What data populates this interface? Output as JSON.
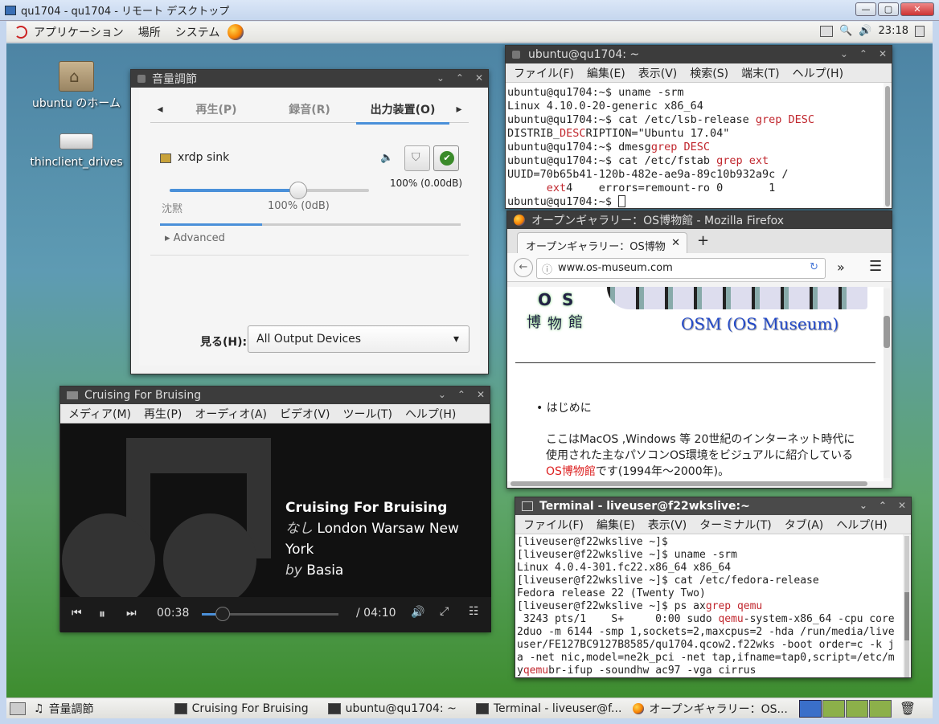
{
  "rdp": {
    "title": "qu1704 - qu1704 - リモート デスクトップ"
  },
  "panel": {
    "menus": [
      "アプリケーション",
      "場所",
      "システム"
    ],
    "clock": "23:18"
  },
  "desktop": {
    "icons": [
      {
        "label": "ubuntu のホーム",
        "icon": "home-folder-icon"
      },
      {
        "label": "thinclient_drives",
        "icon": "drive-icon"
      }
    ]
  },
  "sound": {
    "title": "音量調節",
    "tabs": [
      "再生(P)",
      "録音(R)",
      "出力装置(O)"
    ],
    "selected_tab": "出力装置(O)",
    "device": "xrdp sink",
    "device_volume": "100% (0.00dB)",
    "slider_min_label": "沈黙",
    "slider_value_label": "100% (0dB)",
    "advanced": "Advanced",
    "show_label": "見る(H):",
    "show_value": "All Output Devices"
  },
  "term1": {
    "title": "ubuntu@qu1704: ~",
    "menus": [
      "ファイル(F)",
      "編集(E)",
      "表示(V)",
      "検索(S)",
      "端末(T)",
      "ヘルプ(H)"
    ],
    "lines": [
      "ubuntu@qu1704:~$ uname -srm",
      "Linux 4.10.0-20-generic x86_64",
      "ubuntu@qu1704:~$ cat /etc/lsb-release |grep DESC",
      "DISTRIB_|DESC|RIPTION=\"Ubuntu 17.04\"",
      "ubuntu@qu1704:~$ dmesg|grep DESC",
      "ubuntu@qu1704:~$ cat /etc/fstab |grep ext",
      "UUID=70b65b41-120b-482e-ae9a-89c10b932a9c /",
      "      |ext|4    errors=remount-ro 0       1",
      "ubuntu@qu1704:~$ "
    ]
  },
  "firefox": {
    "title": "オープンギャラリー：OS博物館 - Mozilla Firefox",
    "tab_label": "オープンギャラリー：OS博物",
    "url": "www.os-museum.com",
    "logo_chars": [
      "O",
      "S",
      "博",
      "物",
      "館"
    ],
    "site_title": "OSM (OS Museum)",
    "bullet": "はじめに",
    "para1": "ここはMacOS ,Windows 等 20世紀のインターネット時代に",
    "para2": "使用された主なパソコンOS環境をビジュアルに紹介している",
    "para3_link": "OS博物館",
    "para3_rest": "です(1994年～2000年)。"
  },
  "media": {
    "title": "Cruising For Bruising",
    "menus": [
      "メディア(M)",
      "再生(P)",
      "オーディオ(A)",
      "ビデオ(V)",
      "ツール(T)",
      "ヘルプ(H)"
    ],
    "track": "Cruising For Bruising",
    "album_prefix": "なし",
    "album": "London Warsaw New York",
    "by_prefix": "by",
    "artist": "Basia",
    "elapsed": "00:38",
    "total": "/ 04:10",
    "progress": 0.15
  },
  "term2": {
    "title": "Terminal - liveuser@f22wkslive:~",
    "menus": [
      "ファイル(F)",
      "編集(E)",
      "表示(V)",
      "ターミナル(T)",
      "タブ(A)",
      "ヘルプ(H)"
    ],
    "lines": [
      "[liveuser@f22wkslive ~]$",
      "[liveuser@f22wkslive ~]$ uname -srm",
      "Linux 4.0.4-301.fc22.x86_64 x86_64",
      "[liveuser@f22wkslive ~]$ cat /etc/fedora-release",
      "Fedora release 22 (Twenty Two)",
      "[liveuser@f22wkslive ~]$ ps ax|grep qemu",
      " 3243 pts/1    S+     0:00 sudo |qemu|-system-x86_64 -cpu core",
      "2duo -m 6144 -smp 1,sockets=2,maxcpus=2 -hda /run/media/live",
      "user/FE127BC9127B8585/qu1704.qcow2.f22wks -boot order=c -k j",
      "a -net nic,model=ne2k_pci -net tap,ifname=tap0,script=/etc/m",
      "y|qemu|br-ifup -soundhw ac97 -vga cirrus"
    ]
  },
  "taskbar": {
    "items": [
      "音量調節",
      "Cruising For Bruising",
      "ubuntu@qu1704: ~",
      "Terminal - liveuser@f...",
      "オープンギャラリー：OS..."
    ]
  }
}
